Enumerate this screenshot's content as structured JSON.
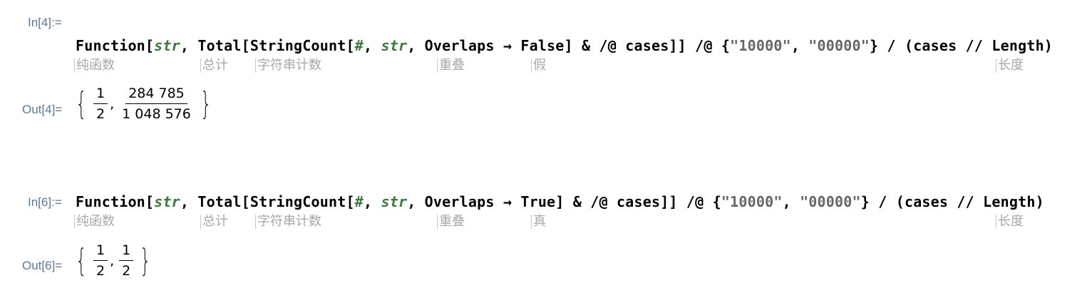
{
  "cells": [
    {
      "in_label": "In[4]:=",
      "code": {
        "p1": "Function[",
        "v1": "str",
        "p2": ", Total[StringCount[",
        "v2": "#",
        "p3": ", ",
        "v3": "str",
        "p4": ", Overlaps → False] & /@ cases]] /@ {",
        "s1": "\"10000\"",
        "p5": ", ",
        "s2": "\"00000\"",
        "p6": "} / (cases // Length)"
      },
      "hints": [
        "纯函数",
        "总计",
        "字符串计数",
        "重叠",
        "假",
        "长度"
      ],
      "out_label": "Out[4]=",
      "output": [
        {
          "num": "1",
          "den": "2"
        },
        {
          "num": "284 785",
          "den": "1 048 576"
        }
      ]
    },
    {
      "in_label": "In[6]:=",
      "code": {
        "p1": "Function[",
        "v1": "str",
        "p2": ", Total[StringCount[",
        "v2": "#",
        "p3": ", ",
        "v3": "str",
        "p4": ", Overlaps → True] & /@ cases]] /@ {",
        "s1": "\"10000\"",
        "p5": ", ",
        "s2": "\"00000\"",
        "p6": "} / (cases // Length)"
      },
      "hints": [
        "纯函数",
        "总计",
        "字符串计数",
        "重叠",
        "真",
        "长度"
      ],
      "out_label": "Out[6]=",
      "output": [
        {
          "num": "1",
          "den": "2"
        },
        {
          "num": "1",
          "den": "2"
        }
      ]
    }
  ]
}
